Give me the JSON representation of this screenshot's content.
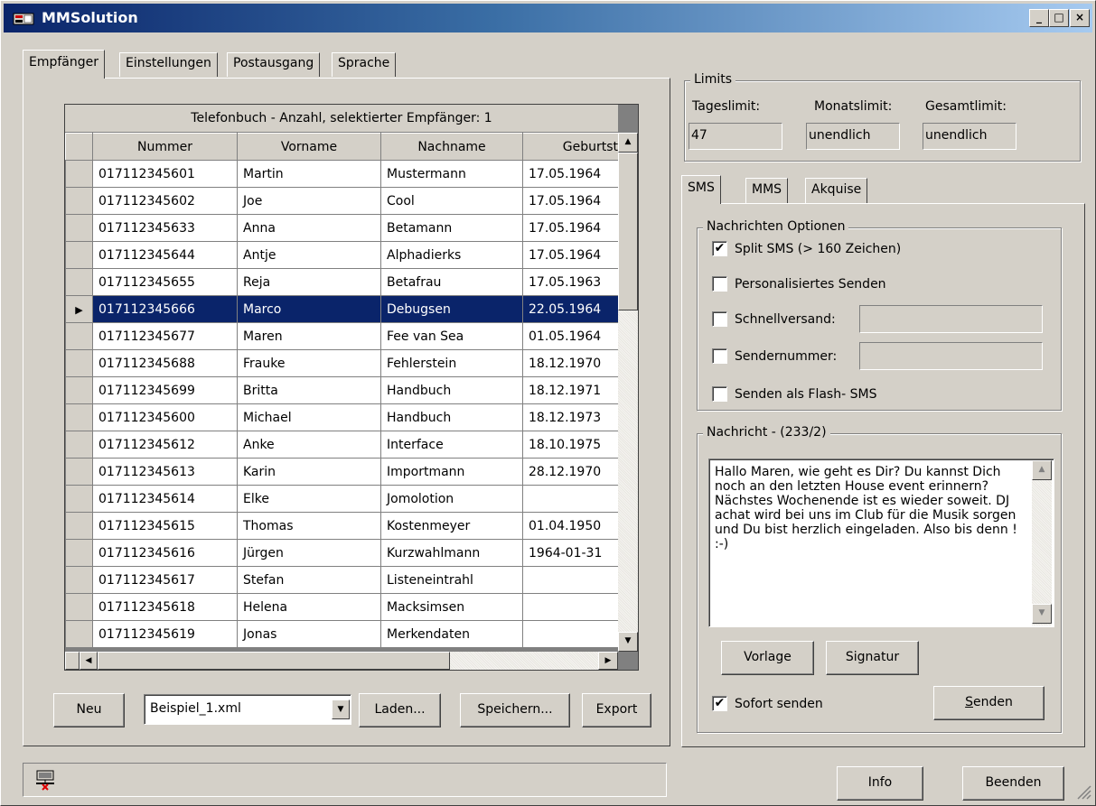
{
  "window": {
    "title": "MMSolution",
    "min": "_",
    "max": "□",
    "close": "×"
  },
  "tabs": [
    "Empfänger",
    "Einstellungen",
    "Postausgang",
    "Sprache"
  ],
  "phonebook": {
    "header": "Telefonbuch   -   Anzahl, selektierter Empfänger: 1",
    "columns": [
      "Nummer",
      "Vorname",
      "Nachname",
      "Geburtst"
    ],
    "selected_index": 5,
    "rows": [
      [
        "017112345601",
        "Martin",
        "Mustermann",
        "17.05.1964"
      ],
      [
        "017112345602",
        "Joe",
        "Cool",
        "17.05.1964"
      ],
      [
        "017112345633",
        "Anna",
        "Betamann",
        "17.05.1964"
      ],
      [
        "017112345644",
        "Antje",
        "Alphadierks",
        "17.05.1964"
      ],
      [
        "017112345655",
        "Reja",
        "Betafrau",
        "17.05.1963"
      ],
      [
        "017112345666",
        "Marco",
        "Debugsen",
        "22.05.1964"
      ],
      [
        "017112345677",
        "Maren",
        "Fee van Sea",
        "01.05.1964"
      ],
      [
        "017112345688",
        "Frauke",
        "Fehlerstein",
        "18.12.1970"
      ],
      [
        "017112345699",
        "Britta",
        "Handbuch",
        "18.12.1971"
      ],
      [
        "017112345600",
        "Michael",
        "Handbuch",
        "18.12.1973"
      ],
      [
        "017112345612",
        "Anke",
        "Interface",
        "18.10.1975"
      ],
      [
        "017112345613",
        "Karin",
        "Importmann",
        "28.12.1970"
      ],
      [
        "017112345614",
        "Elke",
        "Jomolotion",
        ""
      ],
      [
        "017112345615",
        "Thomas",
        "Kostenmeyer",
        "01.04.1950"
      ],
      [
        "017112345616",
        "Jürgen",
        "Kurzwahlmann",
        "1964-01-31"
      ],
      [
        "017112345617",
        "Stefan",
        "Listeneintrahl",
        ""
      ],
      [
        "017112345618",
        "Helena",
        "Macksimsen",
        ""
      ],
      [
        "017112345619",
        "Jonas",
        "Merkendaten",
        ""
      ]
    ]
  },
  "bottom": {
    "neu": "Neu",
    "file": "Beispiel_1.xml",
    "laden": "Laden...",
    "speichern": "Speichern...",
    "export": "Export"
  },
  "limits": {
    "title": "Limits",
    "tag_label": "Tageslimit:",
    "tag_value": "47",
    "monat_label": "Monatslimit:",
    "monat_value": "unendlich",
    "gesamt_label": "Gesamtlimit:",
    "gesamt_value": "unendlich"
  },
  "msgtabs": [
    "SMS",
    "MMS",
    "Akquise"
  ],
  "options": {
    "title": "Nachrichten Optionen",
    "split": "Split SMS (> 160 Zeichen)",
    "personal": "Personalisiertes Senden",
    "schnell": "Schnellversand:",
    "sender": "Sendernummer:",
    "flash": "Senden als Flash- SMS"
  },
  "message": {
    "title": "Nachricht - (233/2)",
    "text": "Hallo  Maren, wie geht es Dir? Du kannst Dich noch an den letzten House event erinnern? Nächstes Wochenende ist es wieder soweit. DJ achat wird bei uns im Club für die Musik sorgen und Du bist herzlich eingeladen. Also bis denn ! :-)",
    "vorlage": "Vorlage",
    "signatur": "Signatur",
    "sofort": "Sofort senden",
    "senden": "Senden"
  },
  "footer": {
    "info": "Info",
    "beenden": "Beenden"
  },
  "check": "✔"
}
